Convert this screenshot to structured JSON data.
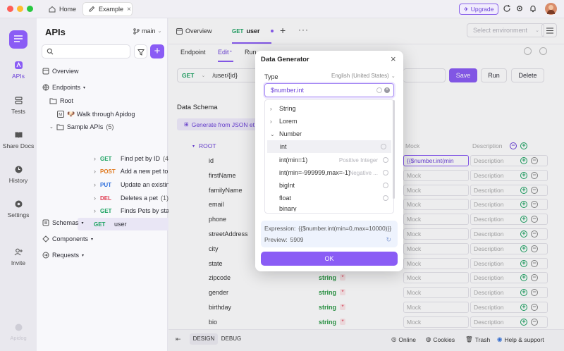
{
  "titlebar": {
    "tabs": [
      {
        "label": "Home"
      },
      {
        "label": "Example"
      }
    ],
    "upgrade_label": "Upgrade"
  },
  "rail": {
    "items": [
      {
        "label": "APIs"
      },
      {
        "label": "Tests"
      },
      {
        "label": "Share Docs"
      },
      {
        "label": "History"
      },
      {
        "label": "Settings"
      },
      {
        "label": "Invite"
      }
    ],
    "footer": "Apidog"
  },
  "sidebar": {
    "title": "APIs",
    "branch": "main",
    "tree": {
      "overview": "Overview",
      "endpoints": "Endpoints",
      "root": "Root",
      "walk": "🐶 Walk through Apidog",
      "folder": "Sample APIs",
      "folder_count": "(5)",
      "items": [
        {
          "method": "GET",
          "name": "Find pet by ID",
          "count": "(4)"
        },
        {
          "method": "POST",
          "name": "Add a new pet to the st...",
          "count": "(1)"
        },
        {
          "method": "PUT",
          "name": "Update an existing pet",
          "count": "(2)"
        },
        {
          "method": "DEL",
          "name": "Deletes a pet",
          "count": "(1)"
        },
        {
          "method": "GET",
          "name": "Finds Pets by status",
          "count": "(2)"
        },
        {
          "method": "GET",
          "name": "user",
          "count": ""
        }
      ],
      "schemas": "Schemas",
      "components": "Components",
      "requests": "Requests"
    }
  },
  "main": {
    "tabs": {
      "overview": "Overview",
      "method": "GET",
      "name": "user"
    },
    "env_placeholder": "Select environment",
    "subtabs": {
      "endpoint": "Endpoint",
      "edit": "Edit",
      "run": "Run"
    },
    "request": {
      "method": "GET",
      "path": "/user/{id}",
      "save": "Save",
      "run": "Run",
      "delete": "Delete"
    },
    "schema": {
      "title": "Data Schema",
      "generate": "Generate from JSON et",
      "root": "ROOT",
      "mock_header": "Mock",
      "desc_header": "Description",
      "mock_placeholder": "Mock",
      "desc_placeholder": "Description",
      "id_mock": "{{$number.int(min",
      "fields": [
        {
          "name": "id",
          "type": ""
        },
        {
          "name": "firstName",
          "type": ""
        },
        {
          "name": "familyName",
          "type": ""
        },
        {
          "name": "email",
          "type": ""
        },
        {
          "name": "phone",
          "type": ""
        },
        {
          "name": "streetAddress",
          "type": ""
        },
        {
          "name": "city",
          "type": ""
        },
        {
          "name": "state",
          "type": ""
        },
        {
          "name": "zipcode",
          "type": "string"
        },
        {
          "name": "gender",
          "type": "string"
        },
        {
          "name": "birthday",
          "type": "string"
        },
        {
          "name": "bio",
          "type": "string"
        }
      ]
    }
  },
  "footer": {
    "design": "DESIGN",
    "debug": "DEBUG",
    "online": "Online",
    "cookies": "Cookies",
    "trash": "Trash",
    "help": "Help & support"
  },
  "dialog": {
    "title": "Data Generator",
    "type_label": "Type",
    "locale": "English (United States)",
    "search_value": "$number.int",
    "groups": [
      {
        "label": "String"
      },
      {
        "label": "Lorem"
      },
      {
        "label": "Number"
      }
    ],
    "options": [
      {
        "label": "int",
        "hint": ""
      },
      {
        "label": "int(min=1)",
        "hint": "Positive Integer"
      },
      {
        "label": "int(min=-999999,max=-1)",
        "hint": "Negative ..."
      },
      {
        "label": "bigInt",
        "hint": ""
      },
      {
        "label": "float",
        "hint": ""
      },
      {
        "label": "binary",
        "hint": ""
      }
    ],
    "expression_label": "Expression:",
    "expression": "{{$number.int(min=0,max=10000)}}",
    "preview_label": "Preview:",
    "preview": "5909",
    "ok": "OK"
  },
  "colors": {
    "accent": "#8a5cf5",
    "get": "#1aa260",
    "post": "#e07a20",
    "put": "#2f6fdc",
    "del": "#e0394f"
  }
}
